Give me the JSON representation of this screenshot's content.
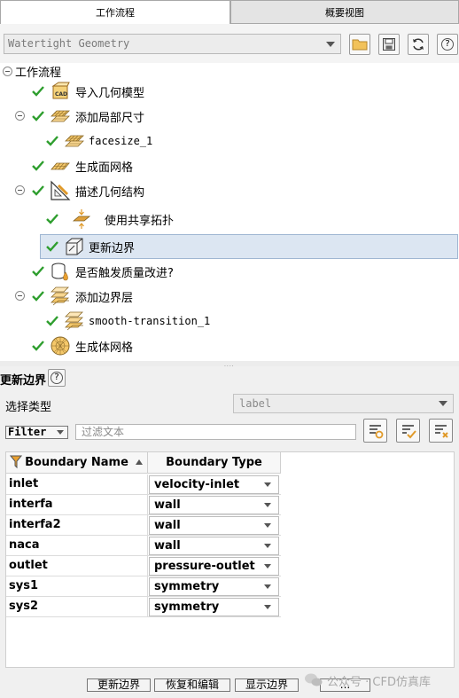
{
  "tabs": {
    "workflow": "工作流程",
    "overview": "概要视图"
  },
  "workflow_select": {
    "value": "Watertight Geometry"
  },
  "tree": {
    "root": "工作流程",
    "items": [
      {
        "label": "导入几何模型"
      },
      {
        "label": "添加局部尺寸"
      },
      {
        "label": "facesize_1"
      },
      {
        "label": "生成面网格"
      },
      {
        "label": "描述几何结构"
      },
      {
        "label": "使用共享拓扑"
      },
      {
        "label": "更新边界"
      },
      {
        "label": "是否触发质量改进?"
      },
      {
        "label": "添加边界层"
      },
      {
        "label": "smooth-transition_1"
      },
      {
        "label": "生成体网格"
      }
    ]
  },
  "panel": {
    "title": "更新边界",
    "help": "?",
    "select_type_label": "选择类型",
    "select_type_value": "label",
    "filter_label": "Filter",
    "filter_placeholder": "过滤文本"
  },
  "table": {
    "headers": {
      "name": "Boundary Name",
      "type": "Boundary Type"
    },
    "rows": [
      {
        "name": "inlet",
        "type": "velocity-inlet"
      },
      {
        "name": "interfa",
        "type": "wall"
      },
      {
        "name": "interfa2",
        "type": "wall"
      },
      {
        "name": "naca",
        "type": "wall"
      },
      {
        "name": "outlet",
        "type": "pressure-outlet"
      },
      {
        "name": "sys1",
        "type": "symmetry"
      },
      {
        "name": "sys2",
        "type": "symmetry"
      }
    ]
  },
  "buttons": {
    "update": "更新边界",
    "revert": "恢复和编辑",
    "show": "显示边界",
    "more": "..."
  },
  "watermark": {
    "text": "公众号 · CFD仿真库"
  },
  "colors": {
    "check": "#2e9e2e",
    "selection": "#dce6f2",
    "icon_orange": "#e9a030"
  }
}
